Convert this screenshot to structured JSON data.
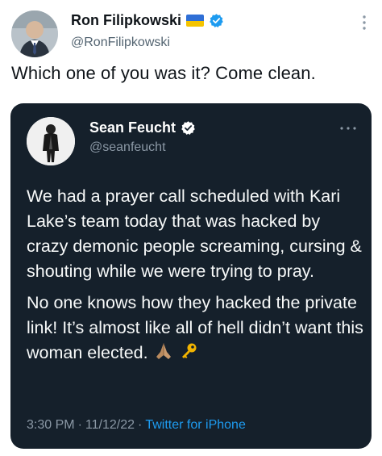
{
  "author": {
    "name": "Ron Filipkowski",
    "handle": "@RonFilipkowski",
    "flag_icon": "ukraine-flag-icon",
    "verified_icon": "verified-badge-icon"
  },
  "tweet": {
    "text": "Which one of you was it? Come clean."
  },
  "quoted": {
    "name": "Sean Feucht",
    "handle": "@seanfeucht",
    "verified_icon": "verified-badge-icon",
    "paragraph1": "We had a prayer call scheduled with Kari Lake’s team today that was hacked by crazy demonic people screaming, cursing & shouting while we were trying to pray.",
    "paragraph2": "No one knows how they hacked the private link! It’s almost like all of hell didn’t want this woman elected.",
    "emoji": [
      "folded-hands-emoji",
      "key-emoji"
    ],
    "time": "3:30 PM",
    "date": "11/12/22",
    "separator": "·",
    "source": "Twitter for iPhone"
  },
  "colors": {
    "card_bg": "#15202b",
    "link": "#1d9bf0",
    "verified": "#1d9bf0",
    "muted_dark": "#8b98a5",
    "muted_light": "#536471"
  }
}
